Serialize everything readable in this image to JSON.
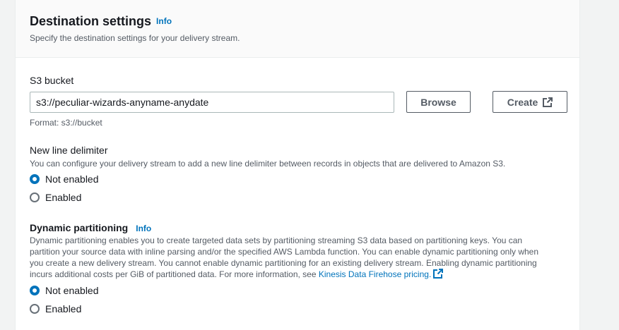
{
  "section": {
    "title": "Destination settings",
    "info": "Info",
    "subtitle": "Specify the destination settings for your delivery stream."
  },
  "s3": {
    "label": "S3 bucket",
    "value": "s3://peculiar-wizards-anyname-anydate",
    "browse_label": "Browse",
    "create_label": "Create",
    "format_hint": "Format: s3://bucket"
  },
  "newline": {
    "label": "New line delimiter",
    "description": "You can configure your delivery stream to add a new line delimiter between records in objects that are delivered to Amazon S3.",
    "options": [
      "Not enabled",
      "Enabled"
    ],
    "selected": "Not enabled"
  },
  "dynamic": {
    "label": "Dynamic partitioning",
    "info": "Info",
    "description_line1": "Dynamic partitioning enables you to create targeted data sets by partitioning streaming S3 data based on partitioning keys. You can",
    "description_line2": "partition your source data with inline parsing and/or the specified AWS Lambda function. You can enable dynamic partitioning only when",
    "description_line3": "you create a new delivery stream. You cannot enable dynamic partitioning for an existing delivery stream. Enabling dynamic partitioning",
    "description_line4": "incurs additional costs per GiB of partitioned data. For more information, see ",
    "pricing_link": "Kinesis Data Firehose pricing.",
    "options": [
      "Not enabled",
      "Enabled"
    ],
    "selected": "Not enabled"
  },
  "colors": {
    "link": "#0073bb",
    "radio_selected": "#0073bb",
    "text": "#16191f",
    "secondary_text": "#545b64"
  },
  "icons": {
    "create_button": "external-link-icon",
    "pricing_link": "external-link-icon"
  }
}
